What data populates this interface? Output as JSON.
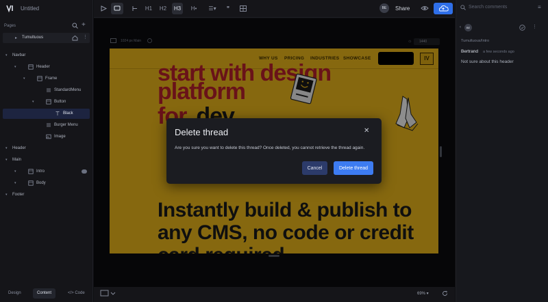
{
  "app": {
    "title": "Untitled"
  },
  "pages": {
    "label": "Pages",
    "items": [
      {
        "name": "Tumultuous"
      }
    ]
  },
  "tree": [
    {
      "label": "Navbar",
      "depth": 0,
      "icon": "none"
    },
    {
      "label": "Header",
      "depth": 1,
      "icon": "frame"
    },
    {
      "label": "Frame",
      "depth": 2,
      "icon": "frame"
    },
    {
      "label": "StandardMenu",
      "depth": 3,
      "icon": "component"
    },
    {
      "label": "Button",
      "depth": 3,
      "icon": "frame"
    },
    {
      "label": "Black",
      "depth": 4,
      "icon": "text"
    },
    {
      "label": "Burger Menu",
      "depth": 3,
      "icon": "component"
    },
    {
      "label": "Image",
      "depth": 3,
      "icon": "image"
    },
    {
      "label": "Header",
      "depth": 0,
      "icon": "none"
    },
    {
      "label": "Main",
      "depth": 0,
      "icon": "none"
    },
    {
      "label": "Intro",
      "depth": 1,
      "icon": "frame"
    },
    {
      "label": "Body",
      "depth": 1,
      "icon": "frame"
    },
    {
      "label": "Footer",
      "depth": 0,
      "icon": "none"
    }
  ],
  "bottom_tabs": {
    "design": "Design",
    "content": "Content",
    "code": "</> Code"
  },
  "toolbar": {
    "tools": [
      "play-icon",
      "comment-icon",
      "block-icon",
      "H1",
      "H2",
      "H3",
      "H•",
      "list-icon",
      "quote-icon",
      "table-icon"
    ],
    "avatar": "BE",
    "share": "Share"
  },
  "canvas": {
    "frame_size": "1024 px Main",
    "width_value": "1440",
    "zoom": "69%"
  },
  "site": {
    "nav": [
      "WHY US",
      "PRICING",
      "INDUSTRIES",
      "SHOWCASE"
    ],
    "logo": "IV",
    "hero_lines": [
      "start with design",
      "platform",
      "for",
      "dev"
    ],
    "big_text": "Instantly build & publish to any CMS, no code or credit card required"
  },
  "modal": {
    "title": "Delete thread",
    "body": "Are you sure you want to delete this thread? Once deleted, you cannot retrieve the thread again.",
    "cancel": "Cancel",
    "confirm": "Delete thread"
  },
  "comments": {
    "search_placeholder": "Search comments",
    "avatar": "BE",
    "path": "Tumultuous/Intro",
    "author": "Bertrand",
    "time": "a few seconds ago",
    "text": "Not sure about this header"
  },
  "colors": {
    "accent": "#3d7cf2",
    "site_bg": "#e7b41a",
    "hero_red": "#b5202b"
  }
}
